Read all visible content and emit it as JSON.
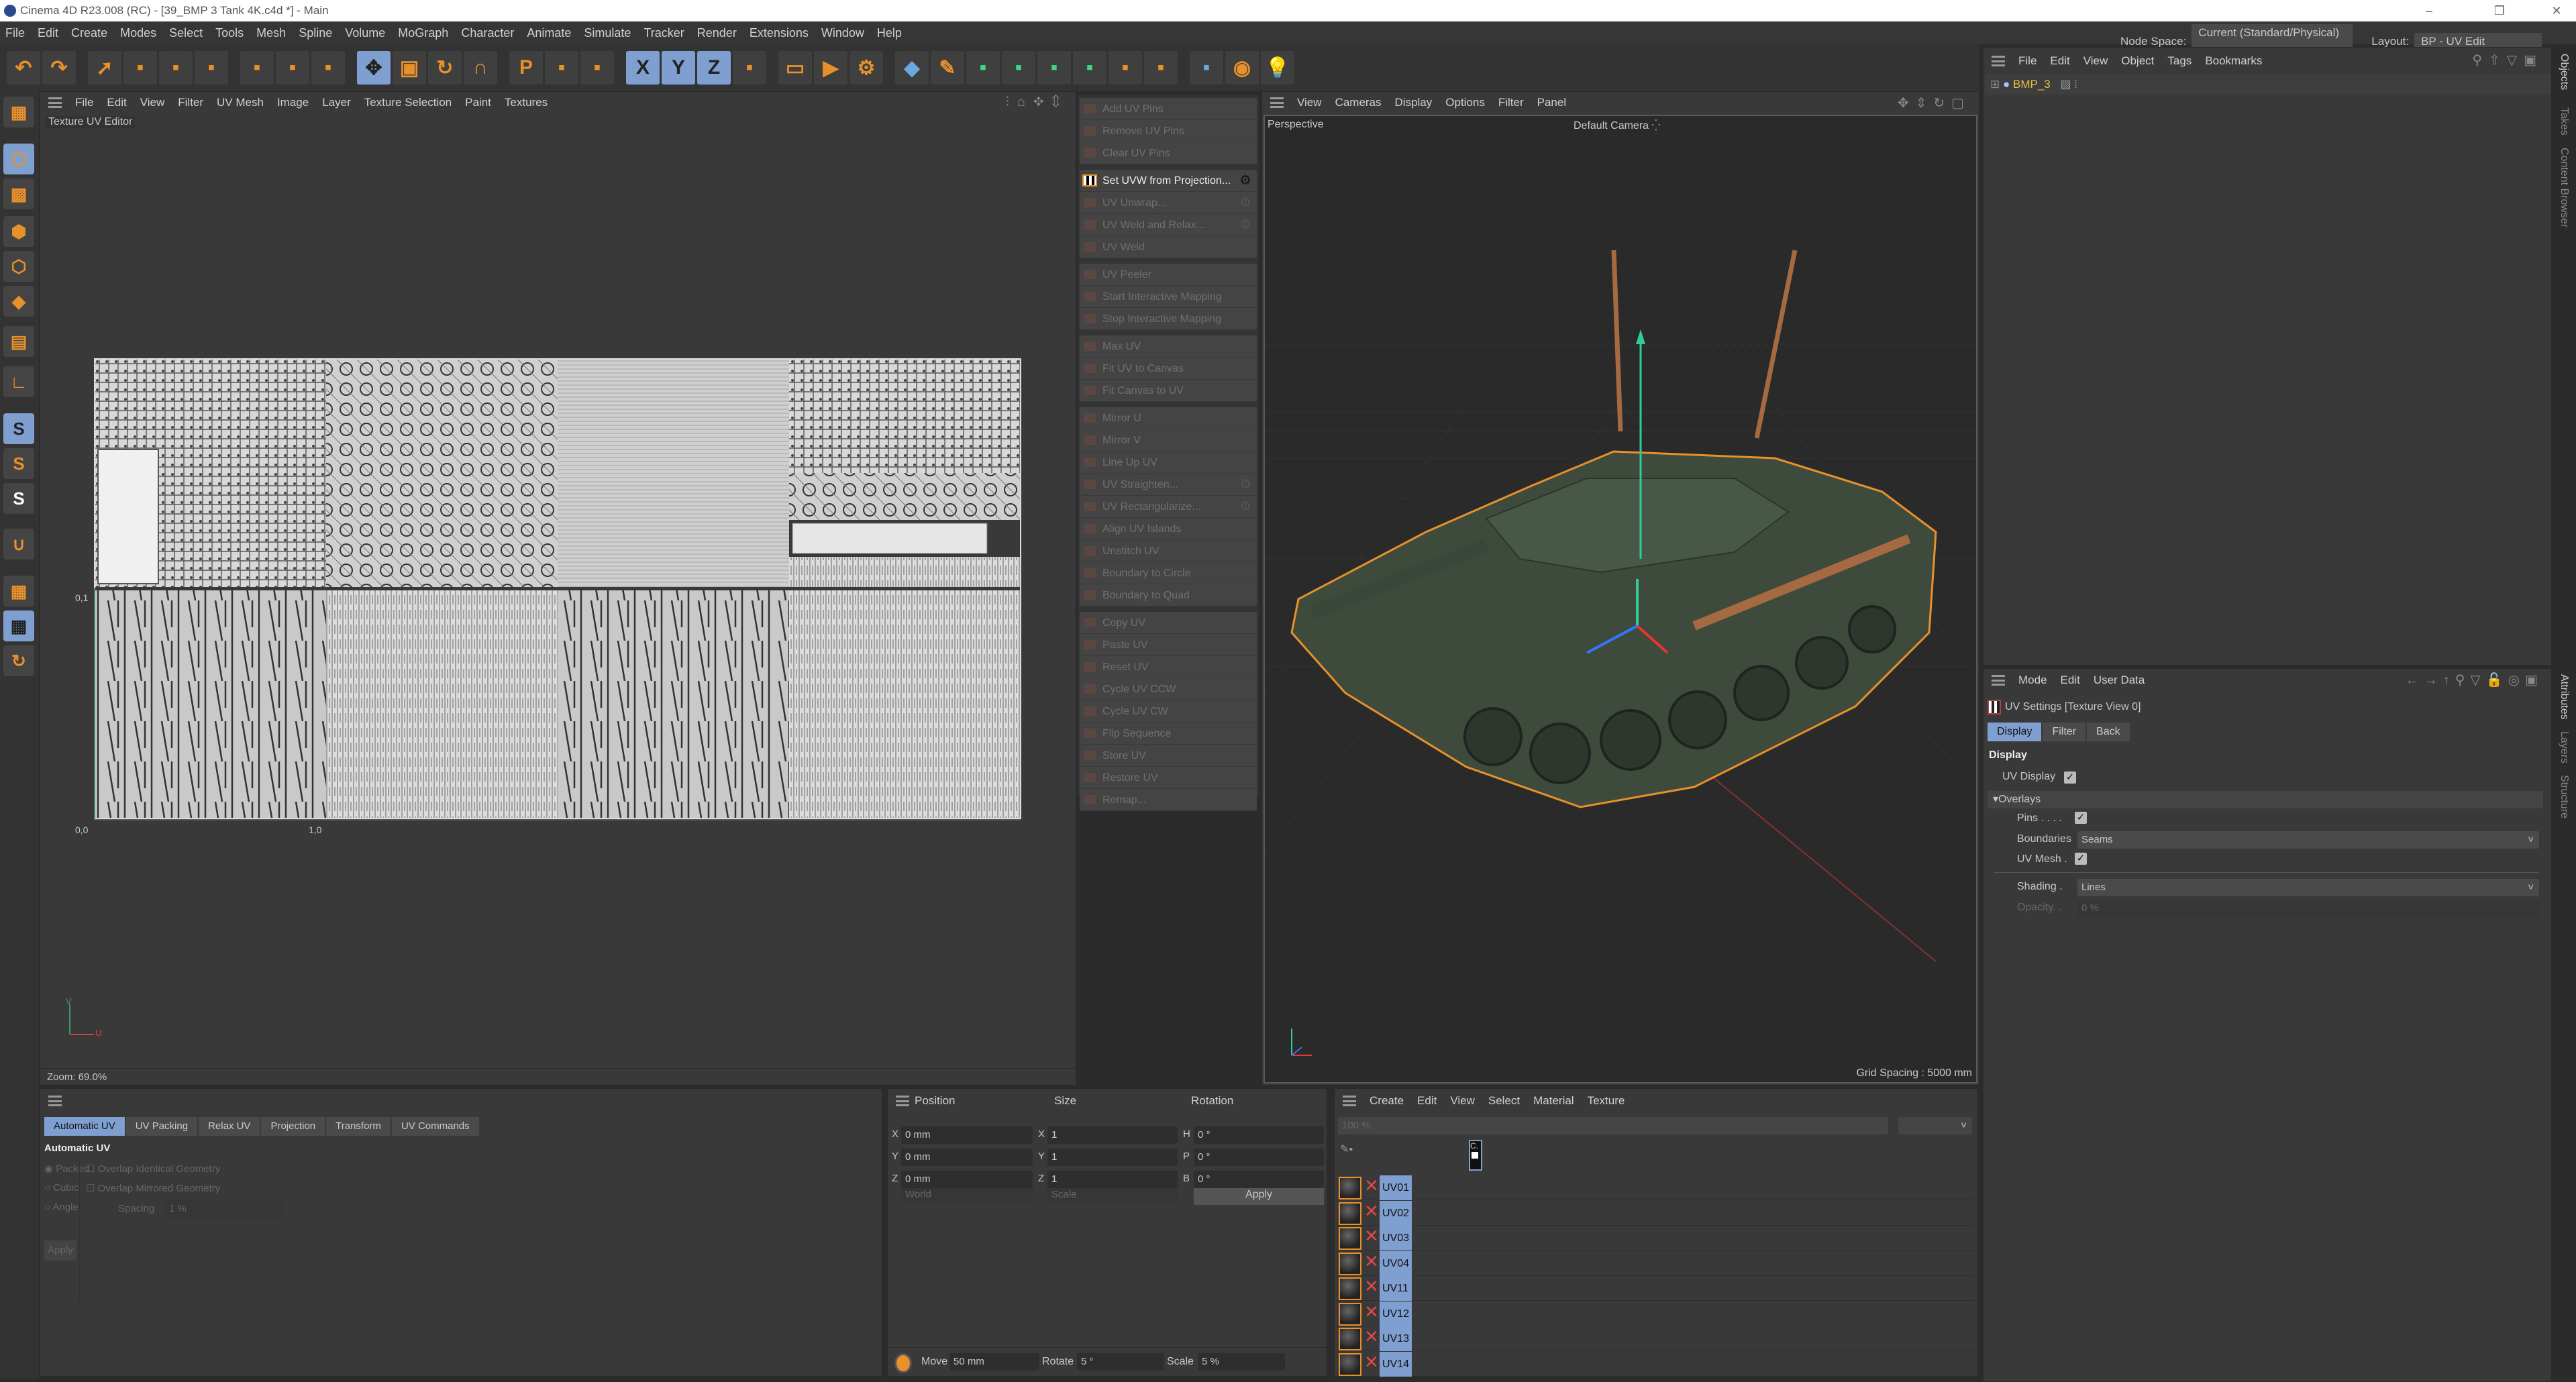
{
  "window": {
    "title": "Cinema 4D R23.008 (RC) - [39_BMP 3 Tank 4K.c4d *] - Main",
    "controls": [
      "–",
      "❐",
      "✕"
    ]
  },
  "menubar": [
    "File",
    "Edit",
    "Create",
    "Modes",
    "Select",
    "Tools",
    "Mesh",
    "Spline",
    "Volume",
    "MoGraph",
    "Character",
    "Animate",
    "Simulate",
    "Tracker",
    "Render",
    "Extensions",
    "Window",
    "Help"
  ],
  "nodespace": {
    "label": "Node Space:",
    "value": "Current (Standard/Physical)"
  },
  "layout": {
    "label": "Layout:",
    "value": "BP - UV Edit"
  },
  "toolbar_icons": [
    "undo-icon",
    "redo-icon",
    "|",
    "live-selection-icon",
    "select-2-icon",
    "select-3-icon",
    "select-4-icon",
    "|",
    "tool-5-icon",
    "tool-6-icon",
    "tool-7-icon",
    "|",
    "move-icon",
    "scale-icon",
    "rotate-icon",
    "magnet-icon",
    "|",
    "psr-icon",
    "axis-icon",
    "move-small-icon",
    "|",
    "x-axis-icon",
    "y-axis-icon",
    "z-axis-icon",
    "coord-system-icon",
    "|",
    "render-view-icon",
    "render-picture-icon",
    "render-settings-icon",
    "|",
    "cube-icon",
    "pen-icon",
    "subdivision-icon",
    "extrude-icon",
    "mograph-icon",
    "cloner-icon",
    "deformer-icon",
    "field-icon",
    "|",
    "floor-icon",
    "camera-icon",
    "light-icon"
  ],
  "toolbar_glyphs": {
    "undo-icon": "↶",
    "redo-icon": "↷",
    "live-selection-icon": "➚",
    "move-icon": "✥",
    "scale-icon": "▣",
    "rotate-icon": "↻",
    "magnet-icon": "∩",
    "psr-icon": "P",
    "x-axis-icon": "X",
    "y-axis-icon": "Y",
    "z-axis-icon": "Z",
    "render-view-icon": "▭",
    "render-picture-icon": "▶",
    "render-settings-icon": "⚙",
    "cube-icon": "◆",
    "pen-icon": "✎",
    "camera-icon": "◉",
    "light-icon": "💡"
  },
  "uv_editor": {
    "menu": [
      "File",
      "Edit",
      "View",
      "Filter",
      "UV Mesh",
      "Image",
      "Layer",
      "Texture Selection",
      "Paint",
      "Textures"
    ],
    "title": "Texture UV Editor",
    "axis_labels": {
      "v1": "0,1",
      "origin": "0,0",
      "u1": "1,0",
      "u": "U",
      "v": "V"
    },
    "zoom": "Zoom: 69.0%"
  },
  "uv_commands": [
    [
      {
        "label": "Add UV Pins"
      },
      {
        "label": "Remove UV Pins"
      },
      {
        "label": "Clear UV Pins"
      }
    ],
    [
      {
        "label": "Set UVW from Projection...",
        "active": true,
        "gear": true
      },
      {
        "label": "UV Unwrap...",
        "gear": true
      },
      {
        "label": "UV Weld and Relax...",
        "gear": true
      },
      {
        "label": "UV Weld"
      }
    ],
    [
      {
        "label": "UV Peeler"
      },
      {
        "label": "Start Interactive Mapping"
      },
      {
        "label": "Stop Interactive Mapping"
      }
    ],
    [
      {
        "label": "Max UV"
      },
      {
        "label": "Fit UV to Canvas"
      },
      {
        "label": "Fit Canvas to UV"
      }
    ],
    [
      {
        "label": "Mirror U"
      },
      {
        "label": "Mirror V"
      },
      {
        "label": "Line Up UV"
      },
      {
        "label": "UV Straighten...",
        "gear": true
      },
      {
        "label": "UV Rectangularize...",
        "gear": true
      },
      {
        "label": "Align UV Islands"
      },
      {
        "label": "Unstitch UV"
      },
      {
        "label": "Boundary to Circle"
      },
      {
        "label": "Boundary to Quad"
      }
    ],
    [
      {
        "label": "Copy UV"
      },
      {
        "label": "Paste UV"
      },
      {
        "label": "Reset UV"
      },
      {
        "label": "Cycle UV CCW"
      },
      {
        "label": "Cycle UV CW"
      },
      {
        "label": "Flip Sequence"
      },
      {
        "label": "Store UV"
      },
      {
        "label": "Restore UV"
      },
      {
        "label": "Remap..."
      }
    ]
  ],
  "viewport": {
    "menu": [
      "View",
      "Cameras",
      "Display",
      "Options",
      "Filter",
      "Panel"
    ],
    "projection": "Perspective",
    "camera": "Default Camera",
    "grid_spacing": "Grid Spacing : 5000 mm",
    "colors": {
      "tank": "#3d4a3c",
      "outline": "#e8912b",
      "barrel": "#a66a42"
    }
  },
  "objects": {
    "menu": [
      "File",
      "Edit",
      "View",
      "Object",
      "Tags",
      "Bookmarks"
    ],
    "items": [
      {
        "name": "BMP_3"
      }
    ]
  },
  "side_tabs_top": [
    "Objects",
    "Takes",
    "Content Browser"
  ],
  "side_tabs_bottom": [
    "Attributes",
    "Layers",
    "Structure"
  ],
  "attributes": {
    "menu": [
      "Mode",
      "Edit",
      "User Data"
    ],
    "title": "UV Settings [Texture View 0]",
    "tabs": [
      "Display",
      "Filter",
      "Back"
    ],
    "section": "Display",
    "uv_display": {
      "label": "UV Display",
      "checked": true
    },
    "overlays": "Overlays",
    "pins": {
      "label": "Pins . . . .",
      "checked": true
    },
    "boundaries": {
      "label": "Boundaries",
      "value": "Seams"
    },
    "uv_mesh": {
      "label": "UV Mesh .",
      "checked": true
    },
    "shading": {
      "label": "Shading .",
      "value": "Lines"
    },
    "opacity": {
      "label": "Opacity. .",
      "value": "0 %"
    }
  },
  "uv_tools": {
    "tabs": [
      "Automatic UV",
      "UV Packing",
      "Relax UV",
      "Projection",
      "Transform",
      "UV Commands"
    ],
    "heading": "Automatic UV",
    "modes": [
      "Packed",
      "Cubic",
      "Angle"
    ],
    "options": [
      "Overlap Identical Geometry",
      "Overlap Mirrored Geometry"
    ],
    "spacing": {
      "label": "Spacing",
      "value": "1 %"
    },
    "apply": "Apply"
  },
  "coordinates": {
    "headers": [
      "Position",
      "Size",
      "Rotation"
    ],
    "rows": [
      {
        "axis": "X",
        "pos": "0 mm",
        "saxis": "X",
        "size": "1",
        "raxis": "H",
        "rot": "0 °"
      },
      {
        "axis": "Y",
        "pos": "0 mm",
        "saxis": "Y",
        "size": "1",
        "raxis": "P",
        "rot": "0 °"
      },
      {
        "axis": "Z",
        "pos": "0 mm",
        "saxis": "Z",
        "size": "1",
        "raxis": "B",
        "rot": "0 °"
      }
    ],
    "space": "World",
    "mode": "Scale",
    "apply": "Apply",
    "move": {
      "label": "Move",
      "value": "50 mm"
    },
    "rotate": {
      "label": "Rotate",
      "value": "5 °"
    },
    "scale": {
      "label": "Scale",
      "value": "5 %"
    }
  },
  "materials": {
    "menu": [
      "Create",
      "Edit",
      "View",
      "Select",
      "Material",
      "Texture"
    ],
    "zoom": "100 %",
    "channel_header": "C.",
    "items": [
      "UV01",
      "UV02",
      "UV03",
      "UV04",
      "UV11",
      "UV12",
      "UV13",
      "UV14"
    ]
  }
}
